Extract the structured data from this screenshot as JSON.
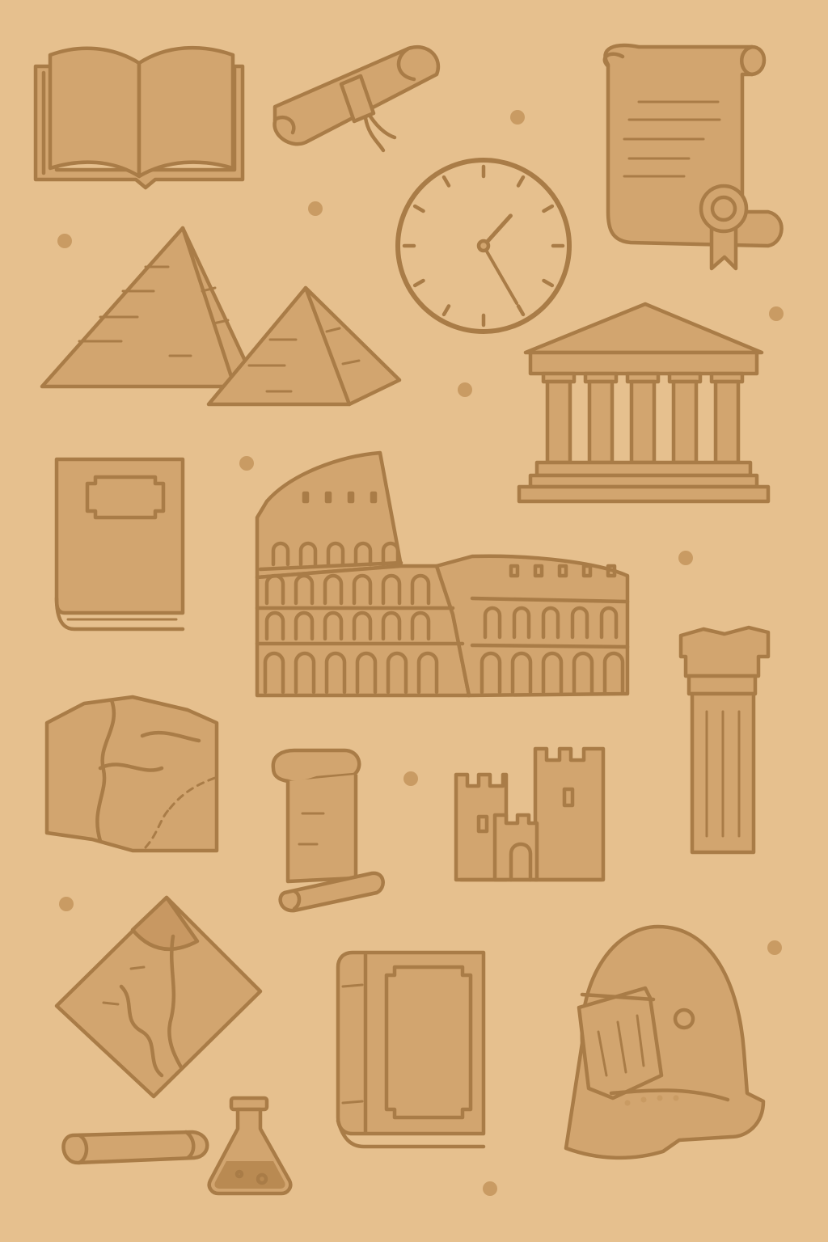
{
  "palette": {
    "paper": "#e6c08e",
    "ink": "#a97c47",
    "fill_shade": "#d2a56f",
    "dot": "#c99b63"
  },
  "icons": [
    "open-book-icon",
    "rolled-scroll-icon",
    "certificate-scroll-icon",
    "clock-icon",
    "pyramids-icon",
    "greek-temple-icon",
    "closed-book-icon",
    "colosseum-icon",
    "broken-column-icon",
    "old-map-icon",
    "unrolled-scroll-icon",
    "castle-icon",
    "diamond-map-icon",
    "thick-book-icon",
    "knight-helmet-icon",
    "small-scroll-icon",
    "flask-icon"
  ],
  "clock": {
    "hour_hand_minutes": 10,
    "minute_hand_minutes": 25
  }
}
